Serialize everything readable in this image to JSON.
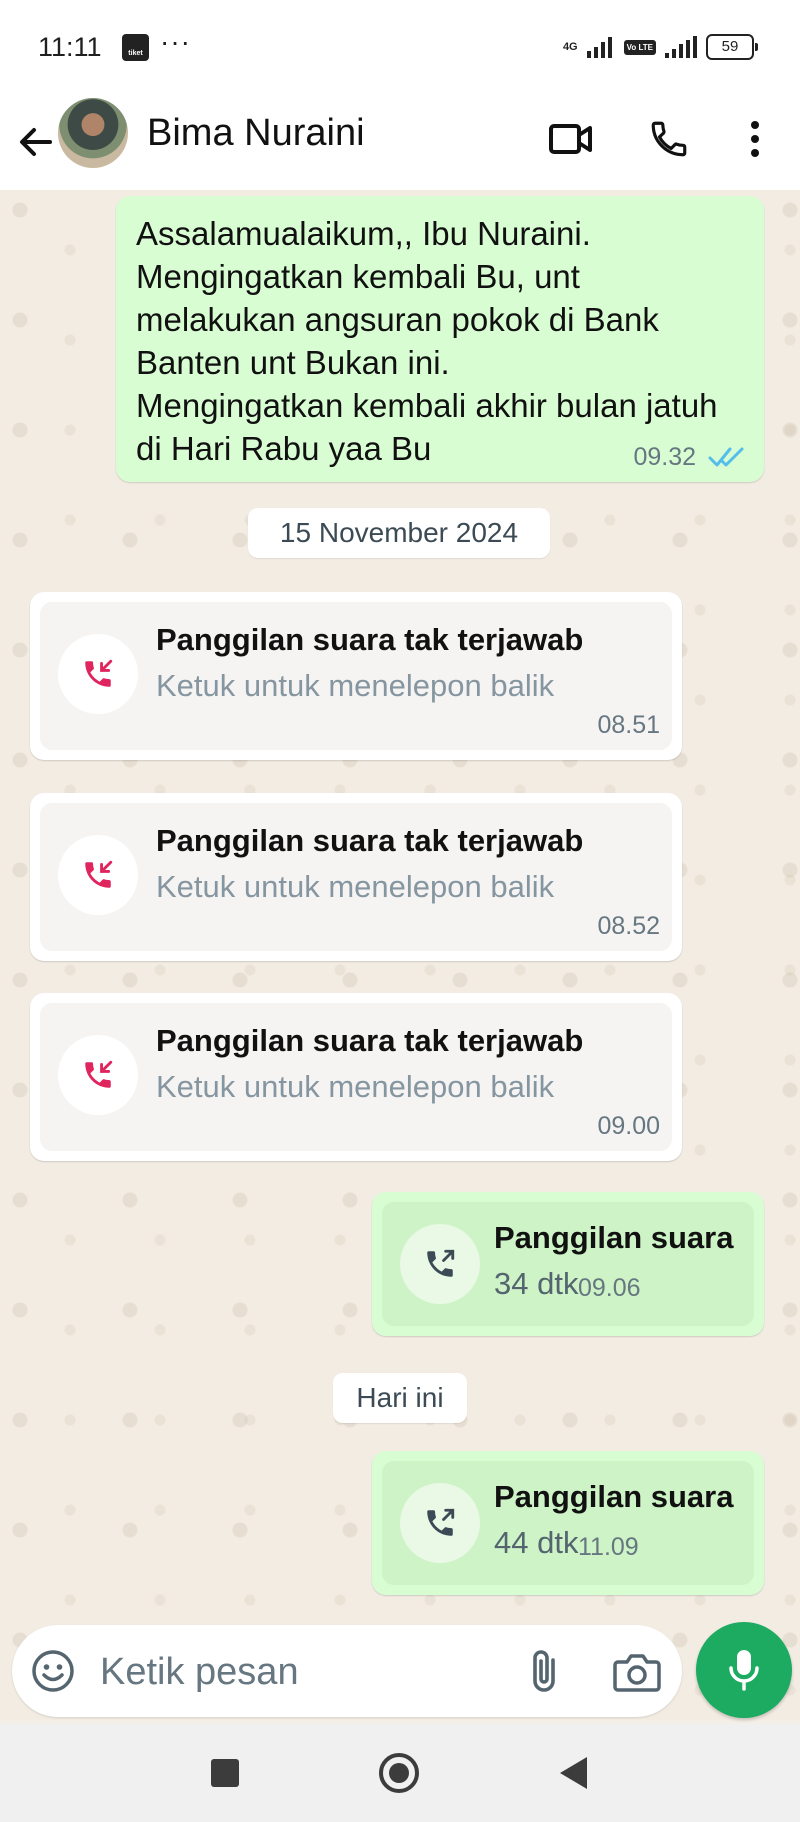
{
  "status_bar": {
    "time": "11:11",
    "notif_label": "tiket",
    "more": "···",
    "network": "4G",
    "volte": "Vo LTE",
    "battery": "59"
  },
  "header": {
    "contact_name": "Bima Nuraini",
    "icons": [
      "back-arrow-icon",
      "video-call-icon",
      "phone-icon",
      "more-vert-icon"
    ]
  },
  "messages": {
    "reminder": {
      "text": "Assalamualaikum,, Ibu Nuraini.\nMengingatkan  kembali Bu, unt melakukan angsuran pokok di Bank Banten unt Bukan ini.\nMengingatkan kembali akhir bulan jatuh di Hari Rabu yaa Bu",
      "time": "09.32",
      "status": "read"
    },
    "date_chip_1": "15 November 2024",
    "missed_calls": [
      {
        "title": "Panggilan suara tak terjawab",
        "subtitle": "Ketuk untuk menelepon balik",
        "time": "08.51"
      },
      {
        "title": "Panggilan suara tak terjawab",
        "subtitle": "Ketuk untuk menelepon balik",
        "time": "08.52"
      },
      {
        "title": "Panggilan suara tak terjawab",
        "subtitle": "Ketuk untuk menelepon balik",
        "time": "09.00"
      }
    ],
    "outgoing_call_1": {
      "title": "Panggilan suara",
      "duration": "34 dtk",
      "time": "09.06"
    },
    "date_chip_2": "Hari ini",
    "outgoing_call_2": {
      "title": "Panggilan suara",
      "duration": "44 dtk",
      "time": "11.09"
    }
  },
  "composer": {
    "placeholder": "Ketik pesan"
  },
  "colors": {
    "outgoing_bubble": "#d9fdd3",
    "missed_call_red": "#e0245e",
    "accent_green": "#1daa61",
    "read_tick_blue": "#53bdeb"
  }
}
